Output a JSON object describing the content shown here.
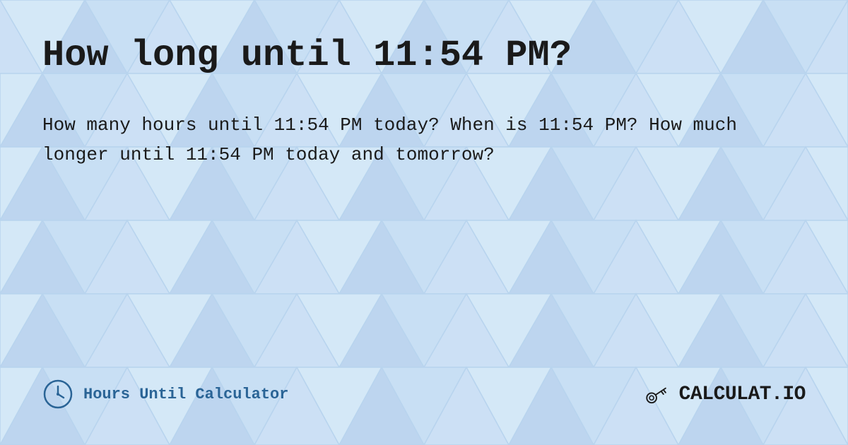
{
  "page": {
    "title": "How long until 11:54 PM?",
    "description": "How many hours until 11:54 PM today? When is 11:54 PM? How much longer until 11:54 PM today and tomorrow?",
    "footer": {
      "left_label": "Hours Until Calculator",
      "right_brand": "CALCULAT.IO"
    },
    "background_color": "#d6e8f7",
    "text_color": "#1a1a1a",
    "accent_color": "#2a6496"
  }
}
